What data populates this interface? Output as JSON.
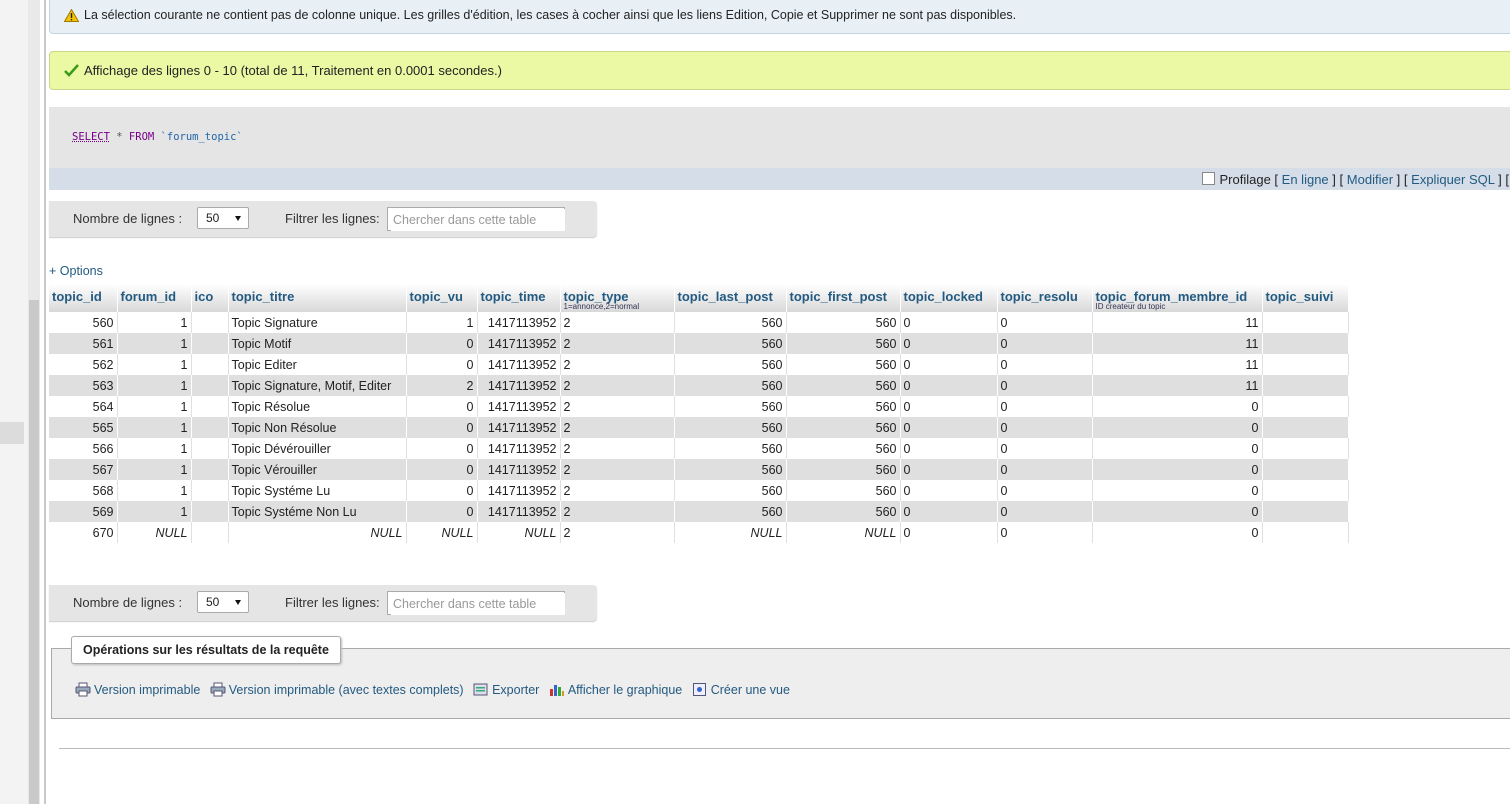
{
  "messages": {
    "warning": "La sélection courante ne contient pas de colonne unique. Les grilles d'édition, les cases à cocher ainsi que les liens Edition, Copie et Supprimer ne sont pas disponibles.",
    "success": "Affichage des lignes 0 - 10 (total de 11, Traitement en 0.0001 secondes.)"
  },
  "sql": {
    "select": "SELECT",
    "star": "*",
    "from": "FROM",
    "table": "`forum_topic`"
  },
  "sql_links": {
    "profilage": "Profilage",
    "en_ligne": "En ligne",
    "modifier": "Modifier",
    "expliquer": "Expliquer SQL",
    "open": "[",
    "close": "]"
  },
  "navigation": {
    "rows_label": "Nombre de lignes :",
    "rows_value": "50",
    "filter_label": "Filtrer les lignes:",
    "filter_placeholder": "Chercher dans cette table"
  },
  "options_link": "+ Options",
  "table": {
    "columns": [
      {
        "name": "topic_id",
        "comment": ""
      },
      {
        "name": "forum_id",
        "comment": ""
      },
      {
        "name": "ico",
        "comment": ""
      },
      {
        "name": "topic_titre",
        "comment": ""
      },
      {
        "name": "topic_vu",
        "comment": ""
      },
      {
        "name": "topic_time",
        "comment": ""
      },
      {
        "name": "topic_type",
        "comment": "1=annonce,2=normal"
      },
      {
        "name": "topic_last_post",
        "comment": ""
      },
      {
        "name": "topic_first_post",
        "comment": ""
      },
      {
        "name": "topic_locked",
        "comment": ""
      },
      {
        "name": "topic_resolu",
        "comment": ""
      },
      {
        "name": "topic_forum_membre_id",
        "comment": "ID createur du topic"
      },
      {
        "name": "topic_suivi",
        "comment": ""
      }
    ],
    "rows": [
      [
        "560",
        "1",
        "",
        "Topic Signature",
        "1",
        "1417113952",
        "2",
        "560",
        "560",
        "0",
        "0",
        "11",
        ""
      ],
      [
        "561",
        "1",
        "",
        "Topic Motif",
        "0",
        "1417113952",
        "2",
        "560",
        "560",
        "0",
        "0",
        "11",
        ""
      ],
      [
        "562",
        "1",
        "",
        "Topic Editer",
        "0",
        "1417113952",
        "2",
        "560",
        "560",
        "0",
        "0",
        "11",
        ""
      ],
      [
        "563",
        "1",
        "",
        "Topic Signature, Motif, Editer",
        "2",
        "1417113952",
        "2",
        "560",
        "560",
        "0",
        "0",
        "11",
        ""
      ],
      [
        "564",
        "1",
        "",
        "Topic Résolue",
        "0",
        "1417113952",
        "2",
        "560",
        "560",
        "0",
        "0",
        "0",
        ""
      ],
      [
        "565",
        "1",
        "",
        "Topic Non Résolue",
        "0",
        "1417113952",
        "2",
        "560",
        "560",
        "0",
        "0",
        "0",
        ""
      ],
      [
        "566",
        "1",
        "",
        "Topic Dévérouiller",
        "0",
        "1417113952",
        "2",
        "560",
        "560",
        "0",
        "0",
        "0",
        ""
      ],
      [
        "567",
        "1",
        "",
        "Topic Vérouiller",
        "0",
        "1417113952",
        "2",
        "560",
        "560",
        "0",
        "0",
        "0",
        ""
      ],
      [
        "568",
        "1",
        "",
        "Topic Systéme Lu",
        "0",
        "1417113952",
        "2",
        "560",
        "560",
        "0",
        "0",
        "0",
        ""
      ],
      [
        "569",
        "1",
        "",
        "Topic Systéme Non Lu",
        "0",
        "1417113952",
        "2",
        "560",
        "560",
        "0",
        "0",
        "0",
        ""
      ],
      [
        "670",
        "NULL",
        "",
        "NULL",
        "NULL",
        "NULL",
        "2",
        "NULL",
        "NULL",
        "0",
        "0",
        "0",
        ""
      ]
    ]
  },
  "operations": {
    "title": "Opérations sur les résultats de la requête",
    "print": "Version imprimable",
    "print_full": "Version imprimable (avec textes complets)",
    "export": "Exporter",
    "chart": "Afficher le graphique",
    "view": "Créer une vue"
  },
  "colors": {
    "link": "#235a81",
    "success_bg": "#ebf8a4",
    "notice_bg": "#e8f0f6"
  }
}
